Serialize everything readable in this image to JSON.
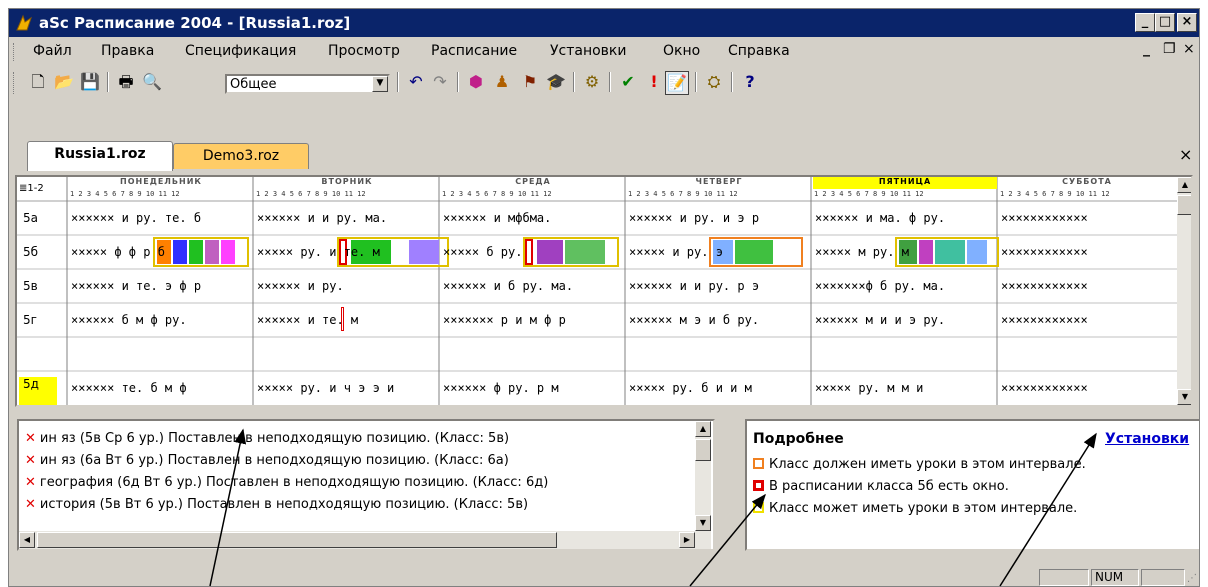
{
  "window": {
    "title": "aSc Расписание 2004  - [Russia1.roz]"
  },
  "menu": [
    "Файл",
    "Правка",
    "Спецификация",
    "Просмотр",
    "Расписание",
    "Установки",
    "Окно",
    "Справка"
  ],
  "toolbar": {
    "combo_value": "Общее"
  },
  "tabs": [
    "Russia1.roz",
    "Demo3.roz"
  ],
  "grid": {
    "corner_label": "1-2",
    "days": [
      "ПОНЕДЕЛЬНИК",
      "ВТОРНИК",
      "СРЕДА",
      "ЧЕТВЕРГ",
      "ПЯТНИЦА",
      "СУББОТА"
    ],
    "highlighted_day": "ПЯТНИЦА",
    "lesson_numbers": "1 2 3 4 5 6 7 8 9 10 11 12",
    "classes": [
      "5а",
      "5б",
      "5в",
      "5г",
      "5д"
    ],
    "selected_class": "5д",
    "rows": [
      {
        "cells": [
          "×××××× и ру. те. б",
          "×××××× и и ру. ма.",
          "×××××× и мфбма.",
          "×××××× и ру. и э р",
          "×××××× и ма. ф ру.",
          "××××××××××××"
        ]
      },
      {
        "cells": [
          "×××××  ф  ф р б",
          "×××××  ру. и те.  м",
          "×××××  б ру.",
          "×××××  и ру. э",
          "×××××  м  ру. м",
          "××××××××××××"
        ]
      },
      {
        "cells": [
          "×××××× и те. э ф р",
          "×××××× и      ру.",
          "×××××× и б ру. ма.",
          "×××××× и и ру. р э",
          "×××××××ф б ру. ма.",
          "××××××××××××"
        ]
      },
      {
        "cells": [
          "×××××× б м ф ру.",
          "×××××× и те.   м",
          "××××××× р и м ф р",
          "×××××× м э и б ру.",
          "×××××× м и и э ру.",
          "××××××××××××"
        ]
      },
      {
        "cells": [
          "×××××× те. б м ф",
          "××××× ру. и ч э э и",
          "×××××× ф ру. р м",
          "××××× ру. б и и м",
          "××××× ру. м м и",
          "××××××××××××"
        ]
      }
    ]
  },
  "errors": [
    "ин яз (5в Ср 6 ур.) Поставлен в неподходящую позицию. (Класс: 5в)",
    "ин яз (6а Вт 6 ур.) Поставлен в неподходящую позицию. (Класс: 6а)",
    "география (6д Вт 6 ур.) Поставлен в неподходящую позицию. (Класс: 6д)",
    "история (5в Вт 6 ур.) Поставлен в неподходящую позицию. (Класс: 5в)"
  ],
  "details": {
    "title": "Подробнее",
    "settings_link": "Установки",
    "legend": [
      {
        "text": "Класс должен иметь уроки в этом интервале.",
        "color": "#f08020"
      },
      {
        "text": "В расписании класса 5б есть окно.",
        "color": "#e00000"
      },
      {
        "text": "Класс может иметь уроки в этом интервале.",
        "color": "#f0e000"
      }
    ]
  },
  "status": {
    "num": "NUM"
  }
}
